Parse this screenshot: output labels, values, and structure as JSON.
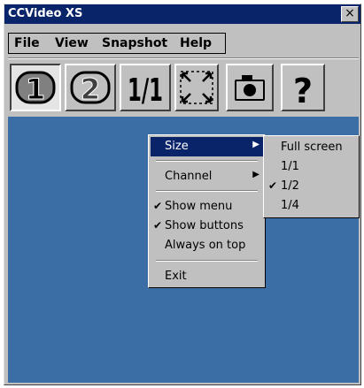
{
  "window": {
    "title": "CCVideo XS",
    "close_glyph": "×"
  },
  "menubar": {
    "items": [
      "File",
      "View",
      "Snapshot",
      "Help"
    ]
  },
  "toolbar": {
    "buttons": [
      {
        "name": "channel-1",
        "icon": "channel-1-icon",
        "label": "1",
        "pressed": true
      },
      {
        "name": "channel-2",
        "icon": "channel-2-icon",
        "label": "2",
        "pressed": false
      },
      {
        "name": "size-1-1",
        "icon": "size-one-to-one-icon",
        "label": "1/1",
        "pressed": false
      },
      {
        "name": "fullscreen",
        "icon": "fullscreen-icon",
        "pressed": false
      },
      {
        "name": "snapshot",
        "icon": "camera-icon",
        "pressed": false
      },
      {
        "name": "help",
        "icon": "help-icon",
        "label": "?",
        "pressed": false
      }
    ]
  },
  "context_menu": {
    "items": [
      {
        "label": "Size",
        "submenu": true,
        "highlighted": true,
        "checked": false
      },
      {
        "label": "Channel",
        "submenu": true,
        "highlighted": false,
        "checked": false
      },
      {
        "label": "Show menu",
        "submenu": false,
        "highlighted": false,
        "checked": true
      },
      {
        "label": "Show buttons",
        "submenu": false,
        "highlighted": false,
        "checked": true
      },
      {
        "label": "Always on top",
        "submenu": false,
        "highlighted": false,
        "checked": false
      },
      {
        "label": "Exit",
        "submenu": false,
        "highlighted": false,
        "checked": false
      }
    ],
    "check_glyph": "✔",
    "arrow_glyph": "▶"
  },
  "size_submenu": {
    "items": [
      {
        "label": "Full screen",
        "checked": false
      },
      {
        "label": "1/1",
        "checked": false
      },
      {
        "label": "1/2",
        "checked": true
      },
      {
        "label": "1/4",
        "checked": false
      }
    ]
  },
  "colors": {
    "titlebar": "#0a246a",
    "client": "#3a6ea5",
    "face": "#c0c0c0",
    "highlight": "#0a246a"
  }
}
